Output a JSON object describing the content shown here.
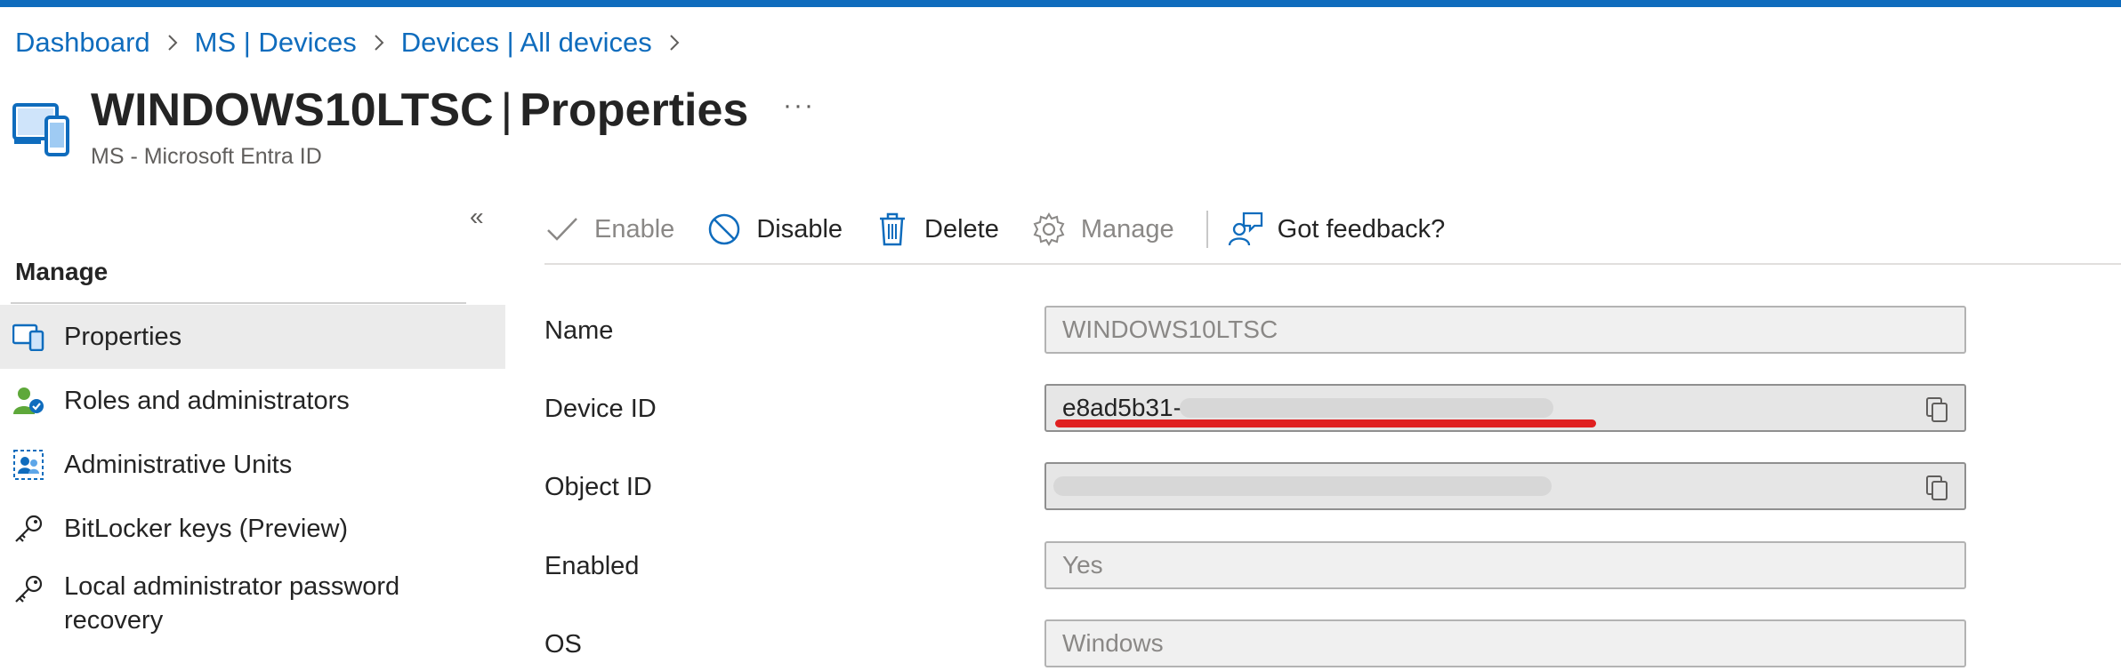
{
  "breadcrumb": {
    "items": [
      "Dashboard",
      "MS | Devices",
      "Devices | All devices"
    ]
  },
  "header": {
    "title_bold": "WINDOWS10LTSC",
    "title_pipe": "|",
    "title_rest": "Properties",
    "more_label": "···",
    "subtitle": "MS - Microsoft Entra ID"
  },
  "sidebar": {
    "collapse_label": "«",
    "section_heading": "Manage",
    "items": [
      {
        "label": "Properties",
        "icon": "device-icon",
        "active": true
      },
      {
        "label": "Roles and administrators",
        "icon": "user-roles-icon",
        "active": false
      },
      {
        "label": "Administrative Units",
        "icon": "admin-units-icon",
        "active": false
      },
      {
        "label": "BitLocker keys (Preview)",
        "icon": "key-icon",
        "active": false
      },
      {
        "label": "Local administrator password recovery",
        "icon": "key-icon",
        "active": false
      }
    ]
  },
  "toolbar": {
    "enable_label": "Enable",
    "disable_label": "Disable",
    "delete_label": "Delete",
    "manage_label": "Manage",
    "feedback_label": "Got feedback?"
  },
  "properties": {
    "name": {
      "label": "Name",
      "value": "WINDOWS10LTSC"
    },
    "device_id": {
      "label": "Device ID",
      "value": "e8ad5b31-"
    },
    "object_id": {
      "label": "Object ID",
      "value": ""
    },
    "enabled": {
      "label": "Enabled",
      "value": "Yes"
    },
    "os": {
      "label": "OS",
      "value": "Windows"
    }
  },
  "colors": {
    "accent": "#0f6cbd",
    "redaction": "#e02020",
    "active_nav_bg": "#ebebeb"
  }
}
